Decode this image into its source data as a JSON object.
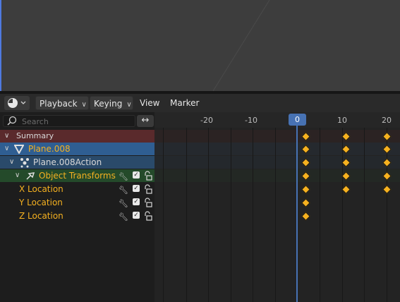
{
  "header": {
    "editor_type_icon": "clock-icon",
    "playback_label": "Playback",
    "keying_label": "Keying",
    "view_label": "View",
    "marker_label": "Marker"
  },
  "search": {
    "placeholder": "Search",
    "icon": "search-icon",
    "swap_icon": "↔"
  },
  "channels": [
    {
      "label": "Summary",
      "color": "#d8d8d8",
      "bg": "#5a2a2c"
    },
    {
      "label": "Plane.008",
      "icon": "mesh-object-icon",
      "color": "#f5b120",
      "bg": "#2f5e92"
    },
    {
      "label": "Plane.008Action",
      "icon": "action-icon",
      "color": "#d8d8d8",
      "bg": "#2a4a6a"
    },
    {
      "label": "Object Transforms",
      "icon": "group-icon",
      "color": "#f5b120",
      "bg": "#244a2a"
    },
    {
      "label": "X Location",
      "color": "#f5b120"
    },
    {
      "label": "Y Location",
      "color": "#f5b120"
    },
    {
      "label": "Z Location",
      "color": "#f5b120"
    }
  ],
  "ruler": {
    "ticks": [
      "-20",
      "-10",
      "0",
      "10",
      "20"
    ],
    "current_frame": "0"
  },
  "keyframes": {
    "Summary": [
      0,
      10,
      20
    ],
    "Plane.008": [
      0,
      10,
      20
    ],
    "Plane.008Action": [
      0,
      10,
      20
    ],
    "Object Transforms": [
      0,
      10,
      20
    ],
    "X Location": [
      0,
      10,
      20
    ],
    "Y Location": [
      0
    ],
    "Z Location": [
      0
    ]
  },
  "colors": {
    "accent": "#4772b3",
    "keyframe": "#f5b120"
  }
}
